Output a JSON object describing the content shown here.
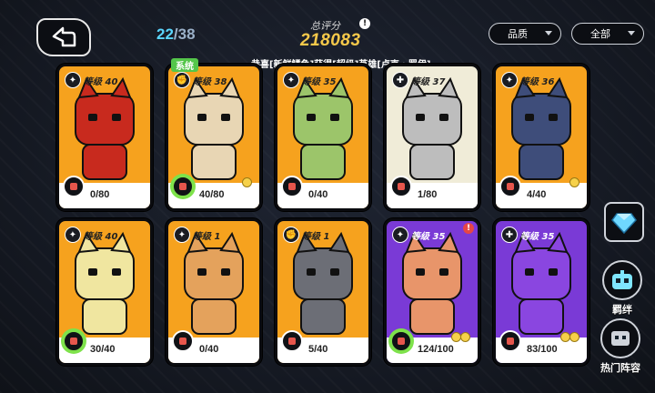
{
  "header": {
    "progress_current": "22",
    "progress_separator": "/",
    "progress_total": "38",
    "score_label": "总评分",
    "info_icon": "!",
    "score_value": "218083",
    "filter_quality": "品质",
    "filter_all": "全部",
    "ticker": "恭喜[新鲜鳞鱼]获得[超级]英雄[卢克・罗伊]"
  },
  "tag": "系统",
  "cards": [
    {
      "level": "等级 40",
      "count": "0/80",
      "theme": "orange"
    },
    {
      "level": "等级 38",
      "count": "40/80",
      "theme": "orange"
    },
    {
      "level": "等级 35",
      "count": "0/40",
      "theme": "orange"
    },
    {
      "level": "等级 37",
      "count": "1/80",
      "theme": "grey"
    },
    {
      "level": "等级 36",
      "count": "4/40",
      "theme": "orange"
    },
    {
      "level": "等级 40",
      "count": "30/40",
      "theme": "orange"
    },
    {
      "level": "等级 1",
      "count": "0/40",
      "theme": "orange"
    },
    {
      "level": "等级 1",
      "count": "5/40",
      "theme": "orange"
    },
    {
      "level": "等级 35",
      "count": "124/100",
      "theme": "purple"
    },
    {
      "level": "等级 35",
      "count": "83/100",
      "theme": "purple"
    }
  ],
  "alert": "!",
  "side": {
    "bond_label": "羁绊",
    "popular_label": "热门阵容"
  },
  "colors": {
    "orange": "#f6a21e",
    "grey": "#f0ecd8",
    "purple": "#7a3ad6",
    "score": "#f6c94a",
    "progress": "#5ad6ff"
  }
}
